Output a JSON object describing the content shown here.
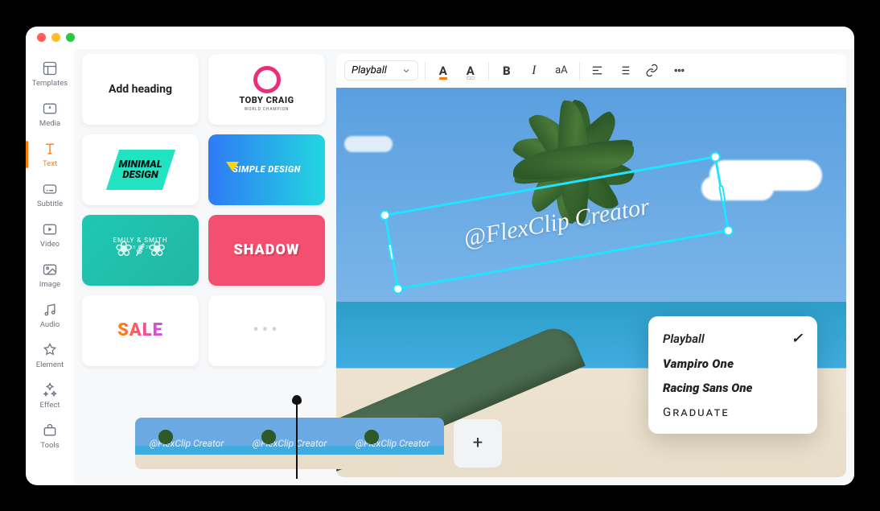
{
  "sidebar": {
    "items": [
      {
        "label": "Templates"
      },
      {
        "label": "Media"
      },
      {
        "label": "Text"
      },
      {
        "label": "Subtitle"
      },
      {
        "label": "Video"
      },
      {
        "label": "Image"
      },
      {
        "label": "Audio"
      },
      {
        "label": "Element"
      },
      {
        "label": "Effect"
      },
      {
        "label": "Tools"
      }
    ]
  },
  "textTemplates": {
    "heading": "Add heading",
    "toby": {
      "brand": "TOBY CRAIG",
      "sub": "WORLD CHAMPION"
    },
    "minimal": "MINIMAL\nDESIGN",
    "simple": "SIMPLE DESIGN",
    "emily": {
      "name": "EMILY & SMITH",
      "date": "15 · 06 · 21"
    },
    "shadow": "SHADOW",
    "sale": "SALE",
    "more": "•••"
  },
  "toolbar": {
    "font": "Playball",
    "case": "aA"
  },
  "canvas": {
    "watermark": "@FlexClip Creator"
  },
  "fontDropdown": {
    "options": [
      {
        "label": "Playball",
        "class": "fo-playball",
        "selected": true
      },
      {
        "label": "Vampiro One",
        "class": "fo-vampiro",
        "selected": false
      },
      {
        "label": "Racing Sans One",
        "class": "fo-racing",
        "selected": false
      },
      {
        "label": "Graduate",
        "class": "fo-graduate",
        "selected": false
      }
    ]
  },
  "timeline": {
    "clipText": "@FlexClip Creator",
    "addLabel": "+"
  }
}
